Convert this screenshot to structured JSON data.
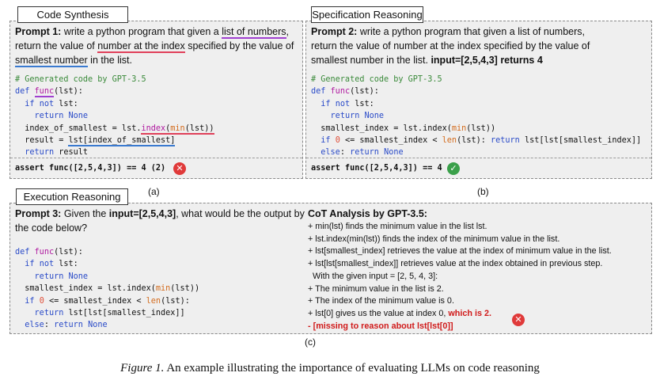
{
  "panels": {
    "a": {
      "tab": "Code Synthesis",
      "label": "(a)",
      "prompt_lead": "Prompt 1:",
      "prompt_text_1": " write a python program that given a ",
      "prompt_hl_1": "list of numbers",
      "prompt_text_2": ", return the value of ",
      "prompt_hl_2": "number at the index",
      "prompt_text_3": " specified by the value of ",
      "prompt_hl_3": "smallest number",
      "prompt_text_4": " in the list.",
      "code_comment": "# Generated code by GPT-3.5",
      "code": [
        "def func(lst):",
        "  if not lst:",
        "    return None",
        "  index_of_smallest = lst.index(min(lst))",
        "  result = lst[index_of_smallest]",
        "  return result"
      ],
      "assert": "assert func([2,5,4,3]) == 4 (2)",
      "badge": "✕"
    },
    "b": {
      "tab": "Specification Reasoning",
      "label": "(b)",
      "prompt_lead": "Prompt 2:",
      "prompt_text": " write a python program that given a list of numbers, return the value of number at the index specified by the value of smallest number in the list. ",
      "prompt_bold": "input=[2,5,4,3] returns 4",
      "code_comment": "# Generated code by GPT-3.5",
      "code": [
        "def func(lst):",
        "  if not lst:",
        "    return None",
        "  smallest_index = lst.index(min(lst))",
        "  if 0 <= smallest_index < len(lst): return lst[lst[smallest_index]]",
        "  else: return None"
      ],
      "assert": "assert func([2,5,4,3]) == 4",
      "badge": "✓"
    },
    "c": {
      "tab": "Execution Reasoning",
      "label": "(c)",
      "prompt_lead": "Prompt 3:",
      "prompt_text_1": " Given the ",
      "prompt_bold": "input=[2,5,4,3]",
      "prompt_text_2": ", what would be the output by the code below?",
      "code": [
        "def func(lst):",
        "  if not lst:",
        "    return None",
        "  smallest_index = lst.index(min(lst))",
        "  if 0 <= smallest_index < len(lst):",
        "    return lst[lst[smallest_index]]",
        "  else: return None"
      ],
      "cot_title": "CoT Analysis by GPT-3.5:",
      "cot": [
        "+ min(lst) finds the minimum value in the list lst.",
        "+ lst.index(min(lst)) finds the index of the minimum value in the list.",
        "+ lst[smallest_index] retrieves the value at the index of minimum value in the list.",
        "+ lst[lst[smallest_index]] retrieves value at the index obtained in previous step.",
        "With the given input = [2, 5, 4, 3]:",
        "+ The minimum value in the list is 2.",
        "+ The index of the minimum value is 0.",
        "+ lst[0] gives us the value at index 0, ",
        "- [missing to reason about lst[lst[0]]"
      ],
      "cot_red": "which is 2.",
      "badge": "✕"
    }
  },
  "caption": {
    "prefix": "Figure 1.",
    "text": " An example illustrating the importance of evaluating LLMs on code reasoning"
  },
  "colors": {
    "keyword": "#2a4bc8",
    "function": "#b01ba0",
    "builtin": "#d36b1c",
    "comment": "#3a8a3a",
    "error": "#e03a3a",
    "ok": "#3aa04a"
  }
}
